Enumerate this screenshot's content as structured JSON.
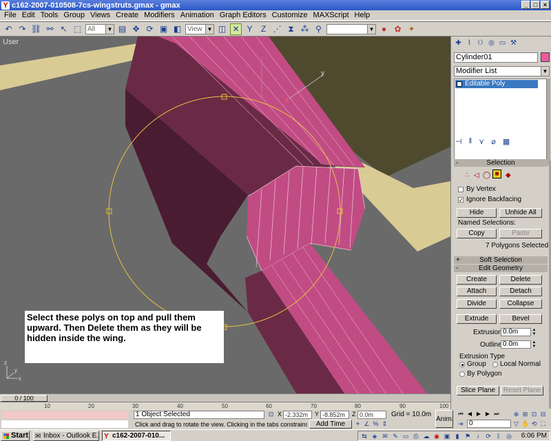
{
  "window": {
    "title": "c162-2007-010508-7cs-wingstruts.gmax - gmax",
    "minimize_glyph": "_",
    "maximize_glyph": "□",
    "close_glyph": "×"
  },
  "menu": [
    "File",
    "Edit",
    "Tools",
    "Group",
    "Views",
    "Create",
    "Modifiers",
    "Animation",
    "Graph Editors",
    "Customize",
    "MAXScript",
    "Help"
  ],
  "toolbar": {
    "selection_filter": "All",
    "reference_coord": "View",
    "named_selection": ""
  },
  "viewport": {
    "label": "User",
    "gizmo_axis_x": "x",
    "gizmo_axis_y": "y",
    "axis_x": "x",
    "axis_y": "y",
    "axis_z": "z",
    "note": "Select these polys on top and pull them upward. Then Delete them as they will be hidden inside the wing."
  },
  "panel": {
    "object_name": "Cylinder01",
    "object_color": "#e55ba0",
    "modifier_list": "Modifier List",
    "stack_item": "Editable Poly",
    "selection": {
      "title": "Selection",
      "by_vertex": "By Vertex",
      "ignore_backfacing": "Ignore Backfacing",
      "ignore_backfacing_checked": "✓",
      "hide": "Hide",
      "unhide_all": "Unhide All",
      "named_selections": "Named Selections:",
      "copy": "Copy",
      "paste": "Paste",
      "status": "7 Polygons Selected"
    },
    "soft_selection": {
      "title": "Soft Selection"
    },
    "edit_geometry": {
      "title": "Edit Geometry",
      "create": "Create",
      "delete": "Delete",
      "attach": "Attach",
      "detach": "Detach",
      "divide": "Divide",
      "collapse": "Collapse",
      "extrude": "Extrude",
      "bevel": "Bevel",
      "extrusion_label": "Extrusion:",
      "extrusion_value": "0.0m",
      "outline_label": "Outline",
      "outline_value": "0.0m",
      "extrusion_type": "Extrusion Type",
      "group": "Group",
      "local_normal": "Local Normal",
      "by_polygon": "By Polygon",
      "slice_plane": "Slice Plane",
      "reset_plane": "Reset Plane"
    },
    "collapse_glyph": "-",
    "expand_glyph": "+"
  },
  "timeline": {
    "slider": "0 / 100",
    "ticks": [
      "10",
      "20",
      "30",
      "40",
      "50",
      "60",
      "70",
      "80",
      "90",
      "100"
    ]
  },
  "status": {
    "selected": "1 Object Selected",
    "prompt": "Click and drag to rotate the view.  Clicking in the tabs constrains the r",
    "x_label": "X",
    "x": "-2.332m",
    "y_label": "Y",
    "y": "-8.852m",
    "z_label": "Z",
    "z": "0.0m",
    "grid": "Grid = 10.0m",
    "add_time_tag": "Add Time Tag",
    "anim": "Anim.",
    "frame": "0"
  },
  "taskbar": {
    "start": "Start",
    "task1": "Inbox - Outlook E...",
    "task2": "c162-2007-010...",
    "clock": "6:06 PM"
  }
}
